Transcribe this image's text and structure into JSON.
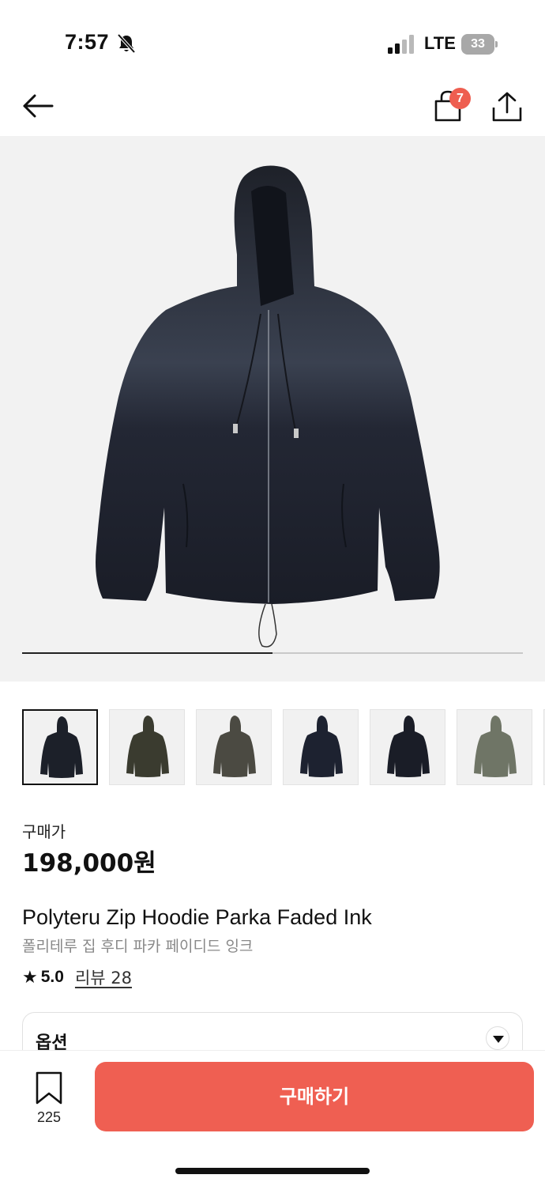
{
  "status_bar": {
    "time": "7:57",
    "network": "LTE",
    "battery": "33"
  },
  "nav": {
    "cart_count": "7"
  },
  "gallery": {
    "progress": 0.5,
    "thumbnail_count": 6,
    "thumbnail_colors": [
      "#1c2029",
      "#3a3b2f",
      "#4b4a42",
      "#1d2230",
      "#1a1d27",
      "#6f7566"
    ]
  },
  "product": {
    "price_label": "구매가",
    "price": "198,000원",
    "name_en": "Polyteru Zip Hoodie Parka Faded Ink",
    "name_ko": "폴리테루 집 후디 파카 페이디드 잉크",
    "rating": "5.0",
    "reviews_label": "리뷰 28"
  },
  "options": {
    "label": "옵션"
  },
  "bottom": {
    "bookmark_count": "225",
    "buy_label": "구매하기"
  },
  "colors": {
    "accent": "#ef5f52",
    "badge": "#ee5e50"
  }
}
